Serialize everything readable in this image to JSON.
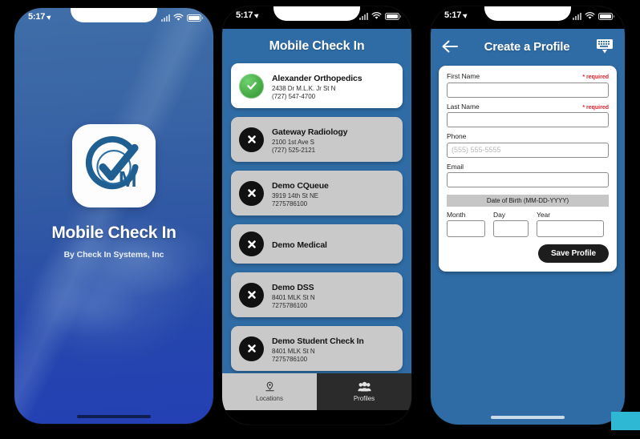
{
  "theme": {
    "brand_blue": "#2f6ca5",
    "splash_blue": "#2546ad",
    "accent_green": "#3fa33f",
    "required_red": "#e0202a",
    "cyan": "#2eb8d4"
  },
  "status_bar": {
    "time": "5:17",
    "location_icon": "location-arrow-icon",
    "signal_icon": "cellular-signal-icon",
    "wifi_icon": "wifi-icon",
    "battery_icon": "battery-icon"
  },
  "phone1": {
    "screen_name": "splash-screen",
    "app_icon_name": "mobile-check-in-logo",
    "title": "Mobile Check In",
    "subtitle": "By Check In Systems, Inc"
  },
  "phone2": {
    "screen_name": "locations-screen",
    "header": "Mobile Check In",
    "locations": [
      {
        "name": "Alexander Orthopedics",
        "address": "2438 Dr M.L.K. Jr St N",
        "phone": "(727) 547-4700",
        "status": "open",
        "status_icon": "check-circle-icon"
      },
      {
        "name": "Gateway Radiology",
        "address": "2100 1st Ave S",
        "phone": "(727) 525-2121",
        "status": "closed",
        "status_icon": "x-circle-icon"
      },
      {
        "name": "Demo CQueue",
        "address": "3919 14th St NE",
        "phone": "7275786100",
        "status": "closed",
        "status_icon": "x-circle-icon"
      },
      {
        "name": "Demo Medical",
        "address": "",
        "phone": "",
        "status": "closed",
        "status_icon": "x-circle-icon"
      },
      {
        "name": "Demo DSS",
        "address": "8401 MLK St N",
        "phone": "7275786100",
        "status": "closed",
        "status_icon": "x-circle-icon"
      },
      {
        "name": "Demo Student Check In",
        "address": "8401 MLK St N",
        "phone": "7275786100",
        "status": "closed",
        "status_icon": "x-circle-icon"
      }
    ],
    "tabs": [
      {
        "label": "Locations",
        "icon": "map-pin-icon",
        "selected": true
      },
      {
        "label": "Profiles",
        "icon": "people-icon",
        "selected": false
      }
    ]
  },
  "phone3": {
    "screen_name": "create-profile-screen",
    "back_icon": "back-arrow-icon",
    "title": "Create a Profile",
    "keyboard_icon": "keyboard-dismiss-icon",
    "fields": [
      {
        "label": "First Name",
        "required_text": "* required",
        "value": "",
        "placeholder": ""
      },
      {
        "label": "Last Name",
        "required_text": "* required",
        "value": "",
        "placeholder": ""
      },
      {
        "label": "Phone",
        "required_text": "",
        "value": "",
        "placeholder": "(555) 555-5555"
      },
      {
        "label": "Email",
        "required_text": "",
        "value": "",
        "placeholder": ""
      }
    ],
    "dob": {
      "bar_label": "Date of Birth (MM-DD-YYYY)",
      "month_label": "Month",
      "day_label": "Day",
      "year_label": "Year",
      "month_value": "",
      "day_value": "",
      "year_value": ""
    },
    "save_label": "Save Profile"
  }
}
